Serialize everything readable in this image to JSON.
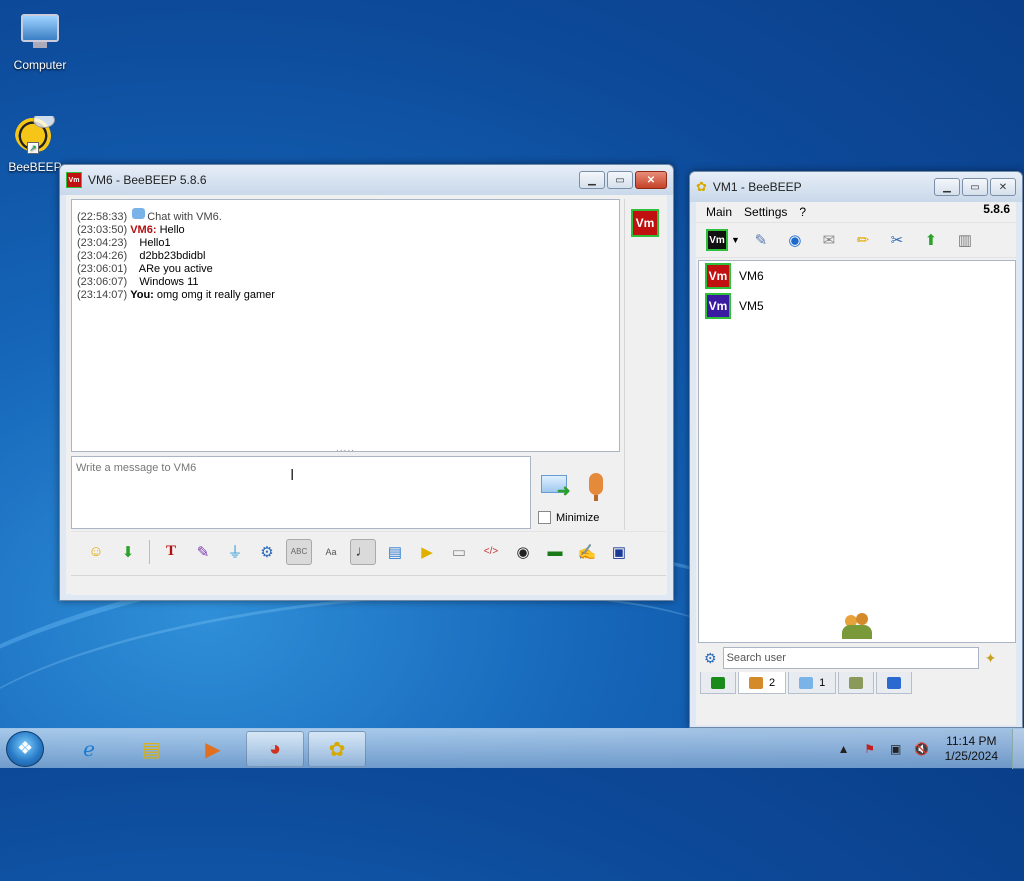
{
  "desktop": {
    "icons": [
      {
        "label": "Computer",
        "icon": "computer-icon"
      },
      {
        "label": "BeeBEEP",
        "icon": "beebeep-bee-icon"
      }
    ]
  },
  "chat_window": {
    "title": "VM6 - BeeBEEP 5.8.6",
    "badge": "Vm",
    "badge_color": "#c01010",
    "log": [
      {
        "time": "(22:58:33)",
        "sender": "",
        "text": "Chat with VM6.",
        "system": true
      },
      {
        "time": "(23:03:50)",
        "sender": "VM6:",
        "text": "Hello",
        "remote": true
      },
      {
        "time": "(23:04:23)",
        "sender": "",
        "text": "Hello1"
      },
      {
        "time": "(23:04:26)",
        "sender": "",
        "text": "d2bb23bdidbl"
      },
      {
        "time": "(23:06:01)",
        "sender": "",
        "text": "ARe you active"
      },
      {
        "time": "(23:06:07)",
        "sender": "",
        "text": "Windows 11"
      },
      {
        "time": "(23:14:07)",
        "sender": "You:",
        "text": "omg omg it really gamer",
        "me": true
      }
    ],
    "input_placeholder": "Write a message to VM6",
    "minimize_label": "Minimize",
    "toolbar_icons": [
      "emoticon-icon",
      "save-icon",
      "font-icon",
      "color-palette-icon",
      "filter-icon",
      "settings-gear-icon",
      "spellcheck-icon",
      "dictionary-icon",
      "music-note-icon",
      "send-file-icon",
      "send-folder-icon",
      "clipboard-icon",
      "code-icon",
      "screenshot-icon",
      "terminal-icon",
      "notes-icon",
      "floppy-save-icon"
    ]
  },
  "main_window": {
    "title": "VM1 - BeeBEEP",
    "menu": [
      "Main",
      "Settings",
      "?"
    ],
    "version": "5.8.6",
    "profile_badge": "Vm",
    "users": [
      {
        "name": "VM6",
        "badge": "Vm",
        "color": "#c01010"
      },
      {
        "name": "VM5",
        "badge": "Vm",
        "color": "#3a1aa0"
      }
    ],
    "search_placeholder": "Search user",
    "tabs": [
      {
        "icon": "home-icon",
        "label": ""
      },
      {
        "icon": "users-icon",
        "label": "2"
      },
      {
        "icon": "chat-icon",
        "label": "1"
      },
      {
        "icon": "groups-icon",
        "label": ""
      },
      {
        "icon": "share-icon",
        "label": ""
      }
    ]
  },
  "taskbar": {
    "apps": [
      "internet-explorer-icon",
      "file-explorer-icon",
      "media-player-icon",
      "chrome-icon",
      "beebeep-icon"
    ],
    "time": "11:14 PM",
    "date": "1/25/2024"
  }
}
